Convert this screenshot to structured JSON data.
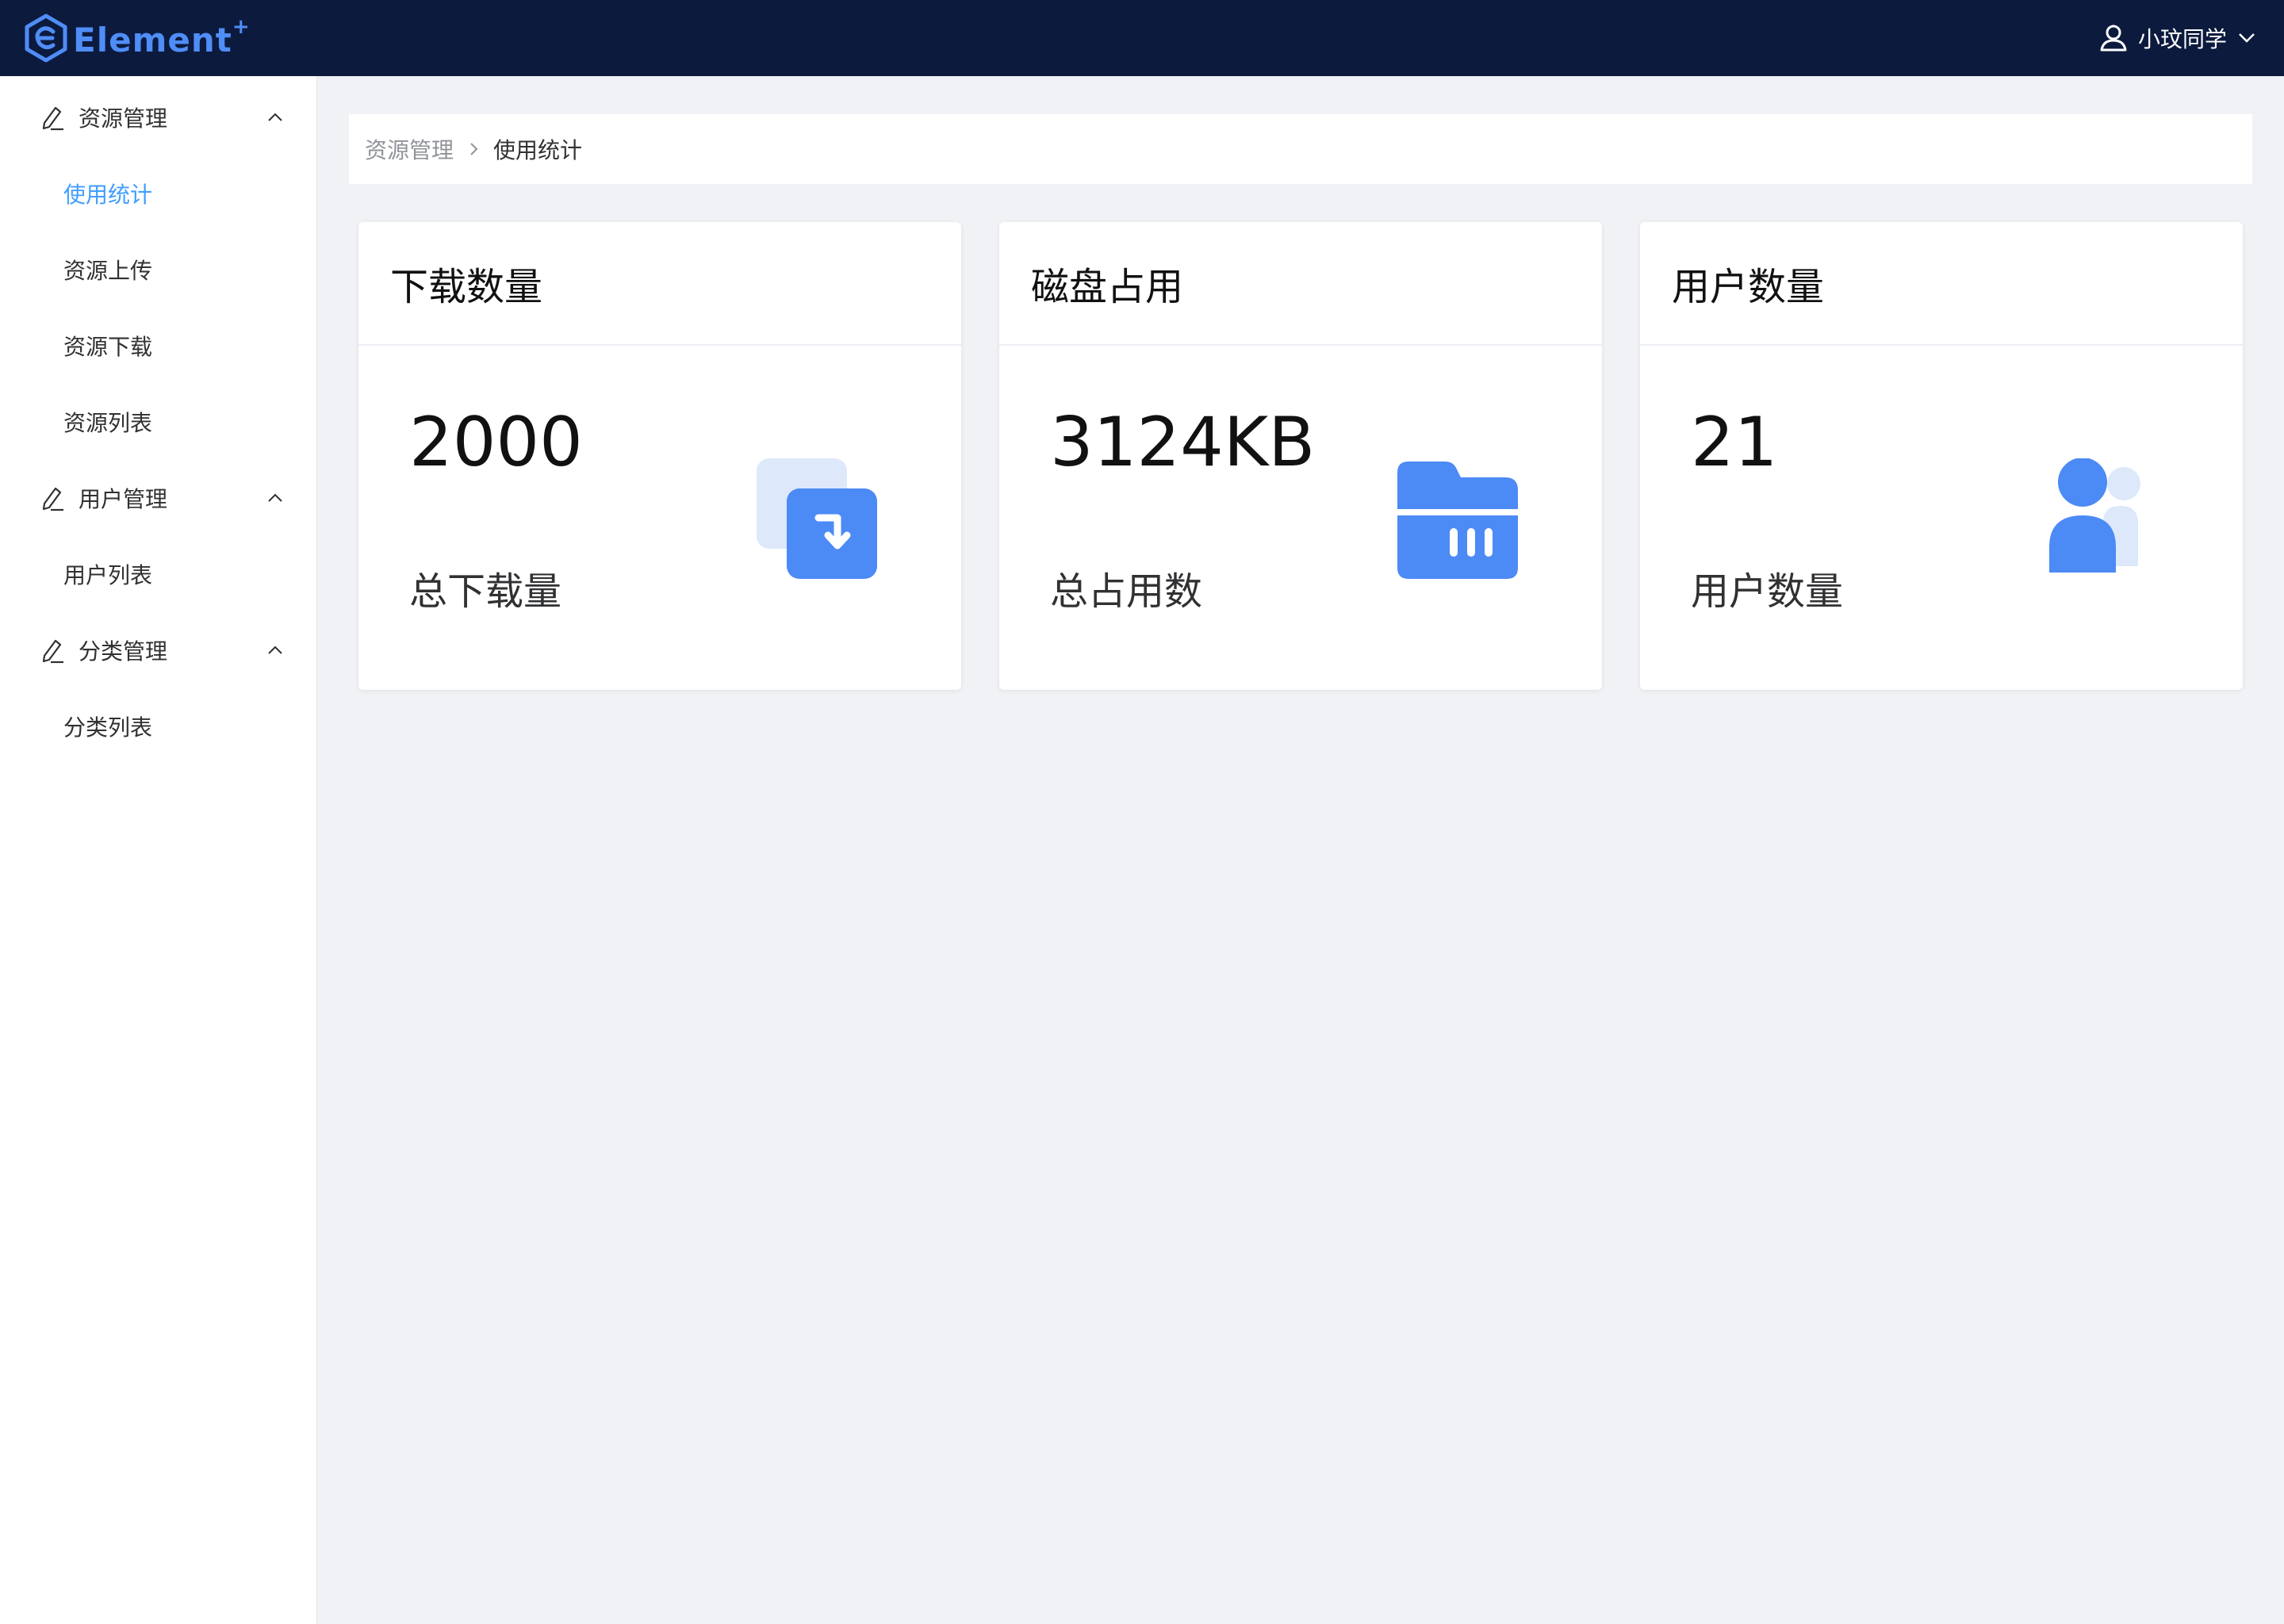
{
  "app": {
    "logo_text": "Element",
    "logo_sup": "+",
    "username": "小玟同学"
  },
  "sidebar": {
    "groups": [
      {
        "label": "资源管理",
        "items": [
          {
            "label": "使用统计",
            "active": true
          },
          {
            "label": "资源上传"
          },
          {
            "label": "资源下载"
          },
          {
            "label": "资源列表"
          }
        ]
      },
      {
        "label": "用户管理",
        "items": [
          {
            "label": "用户列表"
          }
        ]
      },
      {
        "label": "分类管理",
        "items": [
          {
            "label": "分类列表"
          }
        ]
      }
    ]
  },
  "breadcrumb": [
    "资源管理",
    "使用统计"
  ],
  "cards": [
    {
      "title": "下载数量",
      "value": "2000",
      "label": "总下载量",
      "icon": "download-icon"
    },
    {
      "title": "磁盘占用",
      "value": "3124KB",
      "label": "总占用数",
      "icon": "folder-icon"
    },
    {
      "title": "用户数量",
      "value": "21",
      "label": "用户数量",
      "icon": "users-icon"
    }
  ],
  "colors": {
    "header_bg": "#0c1a3e",
    "brand": "#4f8df7",
    "active_menu": "#409eff",
    "page_bg": "#f0f2f5"
  }
}
